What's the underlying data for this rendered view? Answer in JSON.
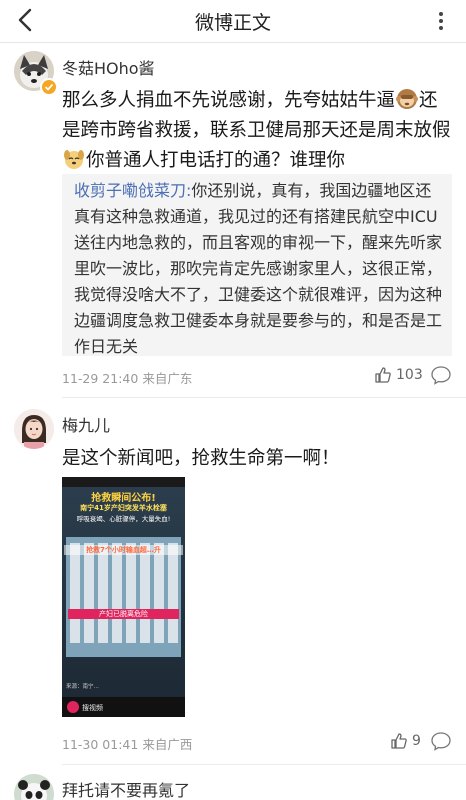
{
  "nav": {
    "title": "微博正文"
  },
  "comments": [
    {
      "username": "冬菇HOho酱",
      "text_part1": "那么多人捐血不先说感谢，先夸姑姑牛逼",
      "text_part2": "还是跨市跨省救援，联系卫健局那天还是周末放假",
      "text_part3": "你普通人打电话打的通？谁理你",
      "quote_author": "收剪子嘞戗菜刀:",
      "quote_text": "你还别说，真有，我国边疆地区还真有这种急救通道，我见过的还有搭建民航空中ICU送往内地急救的，而且客观的审视一下，醒来先听家里吹一波比，那吹完肯定先感谢家里人，这很正常，我觉得没啥大不了，卫健委这个就很难评，因为这种边疆调度急救卫健委本身就是要参与的，和是否是工作日无关",
      "time": "11-29 21:40",
      "location": "来自广东",
      "likes": "103"
    },
    {
      "username": "梅九儿",
      "text": "是这个新闻吧，抢救生命第一啊！",
      "time": "11-30 01:41",
      "location": "来自广西",
      "likes": "9",
      "image": {
        "line1": "抢救瞬间公布!",
        "line2": "南宁41岁产妇突发羊水栓塞",
        "line3": "呼吸衰竭、心脏骤停，大量失血!",
        "line4": "抢救7个小时输血超…升",
        "line5": "产妇已脱离危险",
        "source": "来源：南宁…",
        "watermark": "搜视频"
      }
    },
    {
      "username": "拜托请不要再氪了"
    }
  ]
}
